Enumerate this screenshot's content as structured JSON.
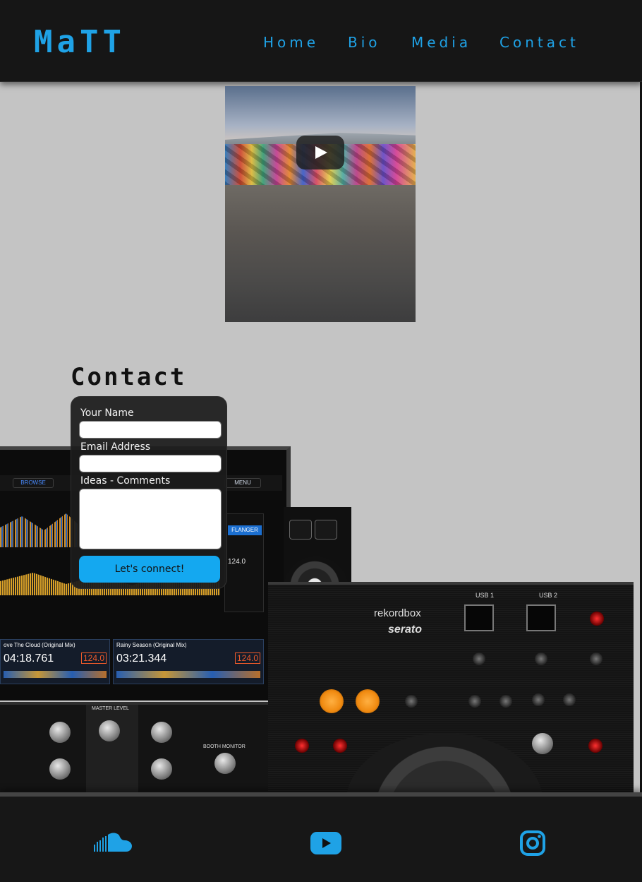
{
  "header": {
    "logo": "MaTT",
    "nav": [
      "Home",
      "Bio",
      "Media",
      "Contact"
    ]
  },
  "video": {
    "play_icon": "play-icon"
  },
  "contact": {
    "title": "Contact",
    "form": {
      "name_label": "Your Name",
      "email_label": "Email Address",
      "comments_label": "Ideas - Comments",
      "submit_label": "Let's connect!"
    }
  },
  "controller_image": {
    "menu_items": [
      "BROWSE",
      "MENU"
    ],
    "fx_label": "FLANGER",
    "fx_bpm": "124.0",
    "deck1": {
      "title": "ove The Cloud (Original Mix)",
      "time": "04:18.761",
      "bpm": "124.0"
    },
    "deck2": {
      "title": "Rainy Season (Original Mix)",
      "time": "03:21.344",
      "bpm": "124.0"
    },
    "brand1": "rekordbox",
    "brand2": "serato",
    "usb1": "USB 1",
    "usb2": "USB 2",
    "master_label": "MASTER LEVEL",
    "booth_label": "BOOTH MONITOR"
  },
  "footer": {
    "icons": [
      "soundcloud-icon",
      "youtube-icon",
      "instagram-icon"
    ]
  },
  "colors": {
    "accent": "#1fa2e6",
    "button": "#14a8f0",
    "background": "#c4c4c4",
    "bar": "#161616"
  }
}
